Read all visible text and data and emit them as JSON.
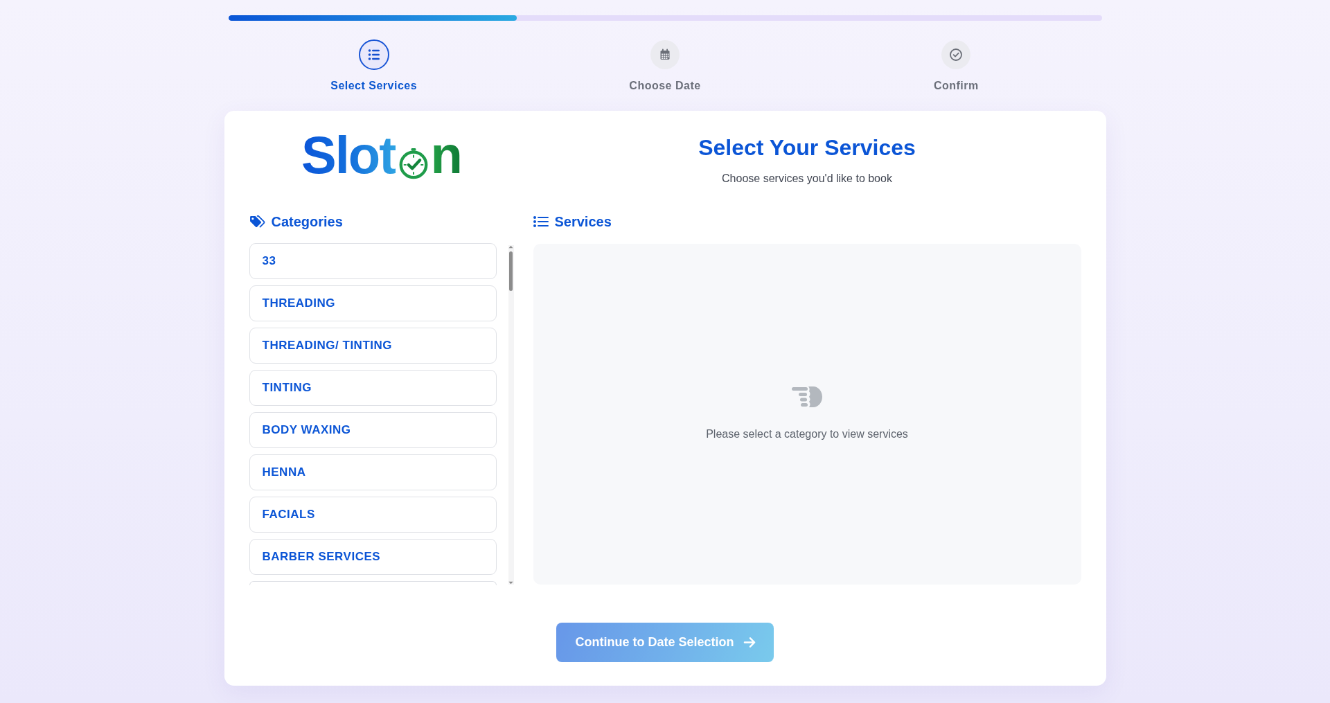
{
  "progress": {
    "level": 0.33
  },
  "steps": [
    {
      "label": "Select Services",
      "kind": "services",
      "current": true
    },
    {
      "label": "Choose Date",
      "kind": "date",
      "current": false
    },
    {
      "label": "Confirm",
      "kind": "confirm",
      "current": false
    }
  ],
  "logo": {
    "lead": "Slot",
    "tail": "n"
  },
  "header": {
    "title": "Select Your Services",
    "subtitle": "Choose services you'd like to book"
  },
  "categories": {
    "heading": "Categories",
    "items": [
      {
        "label": "33",
        "selected": false
      },
      {
        "label": "THREADING",
        "selected": false
      },
      {
        "label": "THREADING/ TINTING",
        "selected": false
      },
      {
        "label": "TINTING",
        "selected": false
      },
      {
        "label": "BODY WAXING",
        "selected": false
      },
      {
        "label": "HENNA",
        "selected": false
      },
      {
        "label": "FACIALS",
        "selected": false
      },
      {
        "label": "BARBER SERVICES",
        "selected": false
      }
    ],
    "more_below": true
  },
  "services": {
    "heading": "Services",
    "empty_message": "Please select a category to view services"
  },
  "continue_button": {
    "label": "Continue to Date Selection",
    "disabled": true
  }
}
